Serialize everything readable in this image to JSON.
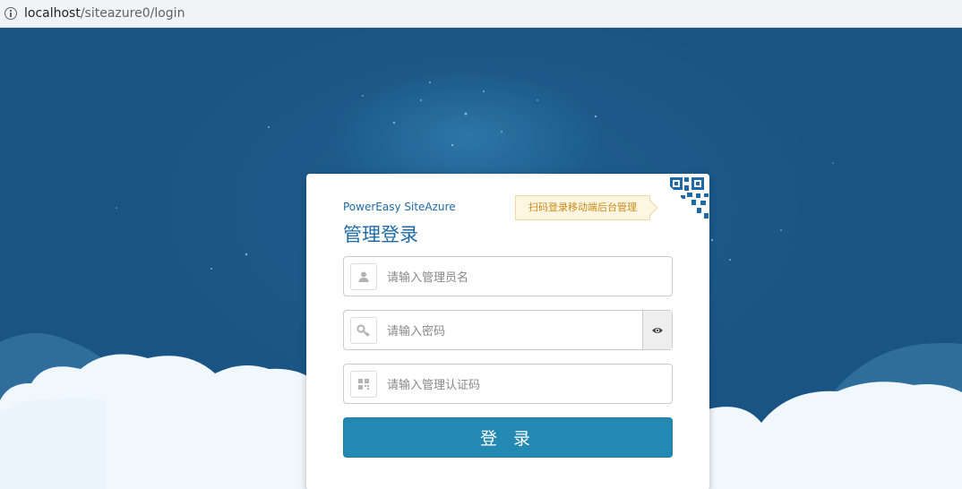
{
  "browser": {
    "url_host": "localhost",
    "url_path": "/siteazure0/login"
  },
  "login": {
    "brand": "PowerEasy SiteAzure",
    "title": "管理登录",
    "qr_tip": "扫码登录移动端后台管理",
    "username_placeholder": "请输入管理员名",
    "password_placeholder": "请输入密码",
    "captcha_placeholder": "请输入管理认证码",
    "submit_label": "登 录"
  },
  "colors": {
    "background": "#1b5787",
    "primary_button": "#2389b2",
    "brand_text": "#1e6aa8",
    "tip_background": "#fef6e0",
    "tip_text": "#c98a1c"
  },
  "icons": {
    "address_bar": "info-icon",
    "username": "user-icon",
    "password": "key-icon",
    "toggle": "eye-icon",
    "captcha": "captcha-icon",
    "qr": "qr-code-icon"
  }
}
